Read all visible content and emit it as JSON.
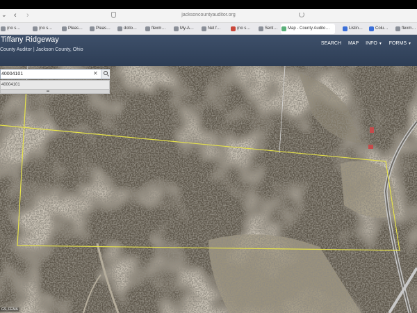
{
  "browser": {
    "url": "jacksoncountyauditor.org",
    "back_glyph": "‹",
    "forward_glyph": "›",
    "menu_glyph": "⌄",
    "tabs": [
      {
        "label": "(no s…"
      },
      {
        "label": "(no s…"
      },
      {
        "label": "Pleas…"
      },
      {
        "label": "Pleas…"
      },
      {
        "label": "dotlo…"
      },
      {
        "label": "flexm…"
      },
      {
        "label": "My-A…"
      },
      {
        "label": "Net f…"
      },
      {
        "label": "(no s…"
      },
      {
        "label": "Sent…"
      },
      {
        "label": "Map - County Audito…"
      },
      {
        "label": "Listin…"
      },
      {
        "label": "Colu…"
      },
      {
        "label": "flexm…"
      }
    ],
    "active_tab_index": 10
  },
  "header": {
    "owner_name": "Tiffany Ridgeway",
    "subtitle": "County Auditor | Jackson County, Ohio",
    "menu": {
      "search": "SEARCH",
      "map": "MAP",
      "info": "INFO",
      "forms": "FORMS"
    }
  },
  "search": {
    "value": "40004101",
    "clear_glyph": "✕",
    "suggestion": "40004101"
  },
  "map": {
    "parcel_line_color": "#e6e24a",
    "road_color": "#c9c9c9",
    "attribution": "GS, FEMA"
  }
}
